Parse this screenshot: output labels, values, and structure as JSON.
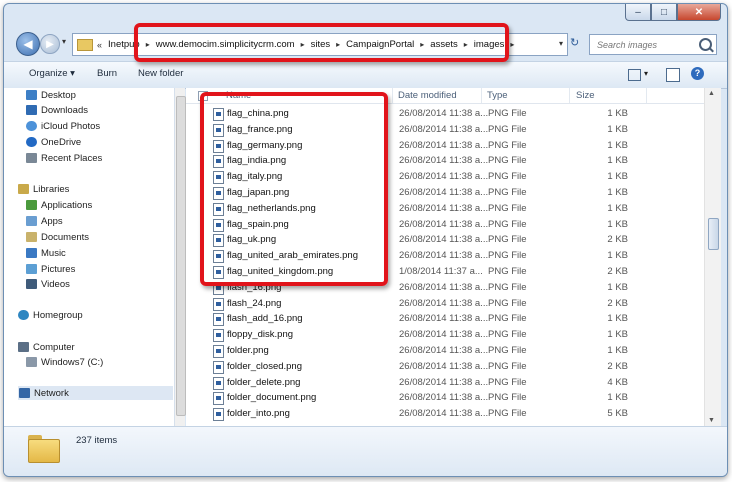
{
  "window": {
    "caption_buttons": {
      "minimize": "–",
      "maximize": "□",
      "close": "✕"
    }
  },
  "nav": {
    "back_glyph": "◀",
    "forward_glyph": "▶",
    "dropdown_glyph": "▾",
    "breadcrumb_prefix": "«",
    "breadcrumbs": [
      "Inetpub",
      "www.democim.simplicitycrm.com",
      "sites",
      "CampaignPortal",
      "assets",
      "images"
    ],
    "separator": "▸",
    "refresh_glyph": "↻",
    "search_placeholder": "Search images"
  },
  "toolbar": {
    "organize": "Organize ▾",
    "burn": "Burn",
    "new_folder": "New folder",
    "views_drop": "▾",
    "help": "?"
  },
  "sidebar": {
    "favorites": [
      {
        "label": "Desktop",
        "icon": "desktop-icon",
        "color": "#3d7fc6"
      },
      {
        "label": "Downloads",
        "icon": "downloads-icon",
        "color": "#2f6bb3"
      },
      {
        "label": "iCloud Photos",
        "icon": "icloud-icon",
        "color": "#4d92d9"
      },
      {
        "label": "OneDrive",
        "icon": "onedrive-icon",
        "color": "#2269c4"
      },
      {
        "label": "Recent Places",
        "icon": "recent-places-icon",
        "color": "#7a8896"
      }
    ],
    "libraries": {
      "label": "Libraries",
      "items": [
        {
          "label": "Applications",
          "icon": "applications-icon",
          "color": "#4b9a3d"
        },
        {
          "label": "Apps",
          "icon": "apps-icon",
          "color": "#6a9ed1"
        },
        {
          "label": "Documents",
          "icon": "documents-icon",
          "color": "#c9b26b"
        },
        {
          "label": "Music",
          "icon": "music-icon",
          "color": "#3a79c3"
        },
        {
          "label": "Pictures",
          "icon": "pictures-icon",
          "color": "#5c9fd4"
        },
        {
          "label": "Videos",
          "icon": "videos-icon",
          "color": "#3f5b7a"
        }
      ]
    },
    "homegroup": {
      "label": "Homegroup",
      "icon": "homegroup-icon",
      "color": "#2e86c1"
    },
    "computer": {
      "label": "Computer",
      "items": [
        {
          "label": "Windows7 (C:)",
          "icon": "drive-icon",
          "color": "#8a98a8"
        }
      ]
    },
    "network": {
      "label": "Network",
      "icon": "network-icon",
      "color": "#3466a5"
    }
  },
  "file_list": {
    "columns": {
      "name": "Name",
      "date": "Date modified",
      "type": "Type",
      "size": "Size"
    },
    "rows": [
      {
        "name": "flag_china.png",
        "date": "26/08/2014 11:38 a...",
        "type": "PNG File",
        "size": "1 KB"
      },
      {
        "name": "flag_france.png",
        "date": "26/08/2014 11:38 a...",
        "type": "PNG File",
        "size": "1 KB"
      },
      {
        "name": "flag_germany.png",
        "date": "26/08/2014 11:38 a...",
        "type": "PNG File",
        "size": "1 KB"
      },
      {
        "name": "flag_india.png",
        "date": "26/08/2014 11:38 a...",
        "type": "PNG File",
        "size": "1 KB"
      },
      {
        "name": "flag_italy.png",
        "date": "26/08/2014 11:38 a...",
        "type": "PNG File",
        "size": "1 KB"
      },
      {
        "name": "flag_japan.png",
        "date": "26/08/2014 11:38 a...",
        "type": "PNG File",
        "size": "1 KB"
      },
      {
        "name": "flag_netherlands.png",
        "date": "26/08/2014 11:38 a...",
        "type": "PNG File",
        "size": "1 KB"
      },
      {
        "name": "flag_spain.png",
        "date": "26/08/2014 11:38 a...",
        "type": "PNG File",
        "size": "1 KB"
      },
      {
        "name": "flag_uk.png",
        "date": "26/08/2014 11:38 a...",
        "type": "PNG File",
        "size": "2 KB"
      },
      {
        "name": "flag_united_arab_emirates.png",
        "date": "26/08/2014 11:38 a...",
        "type": "PNG File",
        "size": "1 KB"
      },
      {
        "name": "flag_united_kingdom.png",
        "date": "1/08/2014 11:37 a...",
        "type": "PNG File",
        "size": "2 KB"
      },
      {
        "name": "flash_16.png",
        "date": "26/08/2014 11:38 a...",
        "type": "PNG File",
        "size": "1 KB"
      },
      {
        "name": "flash_24.png",
        "date": "26/08/2014 11:38 a...",
        "type": "PNG File",
        "size": "2 KB"
      },
      {
        "name": "flash_add_16.png",
        "date": "26/08/2014 11:38 a...",
        "type": "PNG File",
        "size": "1 KB"
      },
      {
        "name": "floppy_disk.png",
        "date": "26/08/2014 11:38 a...",
        "type": "PNG File",
        "size": "1 KB"
      },
      {
        "name": "folder.png",
        "date": "26/08/2014 11:38 a...",
        "type": "PNG File",
        "size": "1 KB"
      },
      {
        "name": "folder_closed.png",
        "date": "26/08/2014 11:38 a...",
        "type": "PNG File",
        "size": "2 KB"
      },
      {
        "name": "folder_delete.png",
        "date": "26/08/2014 11:38 a...",
        "type": "PNG File",
        "size": "4 KB"
      },
      {
        "name": "folder_document.png",
        "date": "26/08/2014 11:38 a...",
        "type": "PNG File",
        "size": "1 KB"
      },
      {
        "name": "folder_into.png",
        "date": "26/08/2014 11:38 a...",
        "type": "PNG File",
        "size": "5 KB"
      }
    ]
  },
  "details": {
    "item_count": "237 items"
  },
  "colors": {
    "annotation": "#e1141b",
    "accent": "#2e6bbd"
  }
}
